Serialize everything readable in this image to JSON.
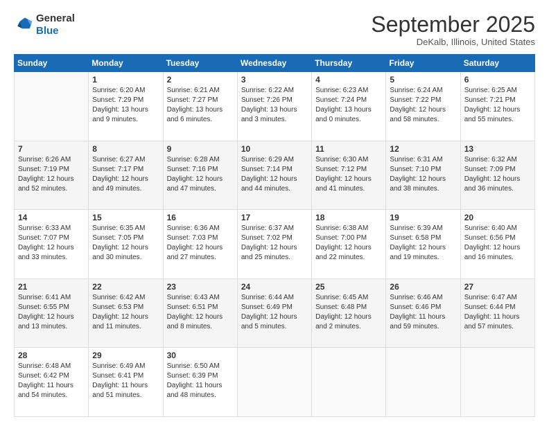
{
  "header": {
    "logo_general": "General",
    "logo_blue": "Blue",
    "month": "September 2025",
    "location": "DeKalb, Illinois, United States"
  },
  "days_of_week": [
    "Sunday",
    "Monday",
    "Tuesday",
    "Wednesday",
    "Thursday",
    "Friday",
    "Saturday"
  ],
  "weeks": [
    [
      {
        "num": "",
        "info": ""
      },
      {
        "num": "1",
        "info": "Sunrise: 6:20 AM\nSunset: 7:29 PM\nDaylight: 13 hours\nand 9 minutes."
      },
      {
        "num": "2",
        "info": "Sunrise: 6:21 AM\nSunset: 7:27 PM\nDaylight: 13 hours\nand 6 minutes."
      },
      {
        "num": "3",
        "info": "Sunrise: 6:22 AM\nSunset: 7:26 PM\nDaylight: 13 hours\nand 3 minutes."
      },
      {
        "num": "4",
        "info": "Sunrise: 6:23 AM\nSunset: 7:24 PM\nDaylight: 13 hours\nand 0 minutes."
      },
      {
        "num": "5",
        "info": "Sunrise: 6:24 AM\nSunset: 7:22 PM\nDaylight: 12 hours\nand 58 minutes."
      },
      {
        "num": "6",
        "info": "Sunrise: 6:25 AM\nSunset: 7:21 PM\nDaylight: 12 hours\nand 55 minutes."
      }
    ],
    [
      {
        "num": "7",
        "info": "Sunrise: 6:26 AM\nSunset: 7:19 PM\nDaylight: 12 hours\nand 52 minutes."
      },
      {
        "num": "8",
        "info": "Sunrise: 6:27 AM\nSunset: 7:17 PM\nDaylight: 12 hours\nand 49 minutes."
      },
      {
        "num": "9",
        "info": "Sunrise: 6:28 AM\nSunset: 7:16 PM\nDaylight: 12 hours\nand 47 minutes."
      },
      {
        "num": "10",
        "info": "Sunrise: 6:29 AM\nSunset: 7:14 PM\nDaylight: 12 hours\nand 44 minutes."
      },
      {
        "num": "11",
        "info": "Sunrise: 6:30 AM\nSunset: 7:12 PM\nDaylight: 12 hours\nand 41 minutes."
      },
      {
        "num": "12",
        "info": "Sunrise: 6:31 AM\nSunset: 7:10 PM\nDaylight: 12 hours\nand 38 minutes."
      },
      {
        "num": "13",
        "info": "Sunrise: 6:32 AM\nSunset: 7:09 PM\nDaylight: 12 hours\nand 36 minutes."
      }
    ],
    [
      {
        "num": "14",
        "info": "Sunrise: 6:33 AM\nSunset: 7:07 PM\nDaylight: 12 hours\nand 33 minutes."
      },
      {
        "num": "15",
        "info": "Sunrise: 6:35 AM\nSunset: 7:05 PM\nDaylight: 12 hours\nand 30 minutes."
      },
      {
        "num": "16",
        "info": "Sunrise: 6:36 AM\nSunset: 7:03 PM\nDaylight: 12 hours\nand 27 minutes."
      },
      {
        "num": "17",
        "info": "Sunrise: 6:37 AM\nSunset: 7:02 PM\nDaylight: 12 hours\nand 25 minutes."
      },
      {
        "num": "18",
        "info": "Sunrise: 6:38 AM\nSunset: 7:00 PM\nDaylight: 12 hours\nand 22 minutes."
      },
      {
        "num": "19",
        "info": "Sunrise: 6:39 AM\nSunset: 6:58 PM\nDaylight: 12 hours\nand 19 minutes."
      },
      {
        "num": "20",
        "info": "Sunrise: 6:40 AM\nSunset: 6:56 PM\nDaylight: 12 hours\nand 16 minutes."
      }
    ],
    [
      {
        "num": "21",
        "info": "Sunrise: 6:41 AM\nSunset: 6:55 PM\nDaylight: 12 hours\nand 13 minutes."
      },
      {
        "num": "22",
        "info": "Sunrise: 6:42 AM\nSunset: 6:53 PM\nDaylight: 12 hours\nand 11 minutes."
      },
      {
        "num": "23",
        "info": "Sunrise: 6:43 AM\nSunset: 6:51 PM\nDaylight: 12 hours\nand 8 minutes."
      },
      {
        "num": "24",
        "info": "Sunrise: 6:44 AM\nSunset: 6:49 PM\nDaylight: 12 hours\nand 5 minutes."
      },
      {
        "num": "25",
        "info": "Sunrise: 6:45 AM\nSunset: 6:48 PM\nDaylight: 12 hours\nand 2 minutes."
      },
      {
        "num": "26",
        "info": "Sunrise: 6:46 AM\nSunset: 6:46 PM\nDaylight: 11 hours\nand 59 minutes."
      },
      {
        "num": "27",
        "info": "Sunrise: 6:47 AM\nSunset: 6:44 PM\nDaylight: 11 hours\nand 57 minutes."
      }
    ],
    [
      {
        "num": "28",
        "info": "Sunrise: 6:48 AM\nSunset: 6:42 PM\nDaylight: 11 hours\nand 54 minutes."
      },
      {
        "num": "29",
        "info": "Sunrise: 6:49 AM\nSunset: 6:41 PM\nDaylight: 11 hours\nand 51 minutes."
      },
      {
        "num": "30",
        "info": "Sunrise: 6:50 AM\nSunset: 6:39 PM\nDaylight: 11 hours\nand 48 minutes."
      },
      {
        "num": "",
        "info": ""
      },
      {
        "num": "",
        "info": ""
      },
      {
        "num": "",
        "info": ""
      },
      {
        "num": "",
        "info": ""
      }
    ]
  ]
}
